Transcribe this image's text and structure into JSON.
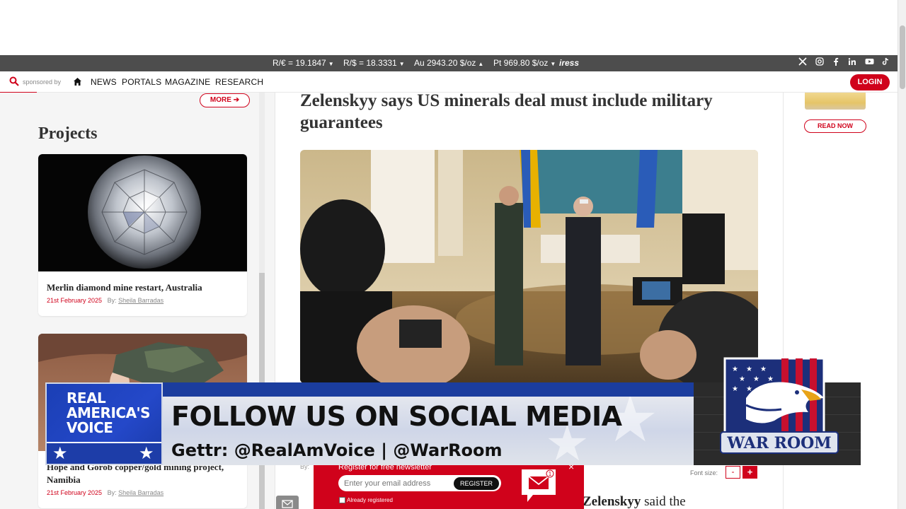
{
  "ticker": {
    "items": [
      {
        "label": "R/€ = 19.1847"
      },
      {
        "label": "R/$ = 18.3331"
      },
      {
        "label": "Au 2943.20 $/oz"
      },
      {
        "label": "Pt 969.80 $/oz"
      }
    ],
    "brand": "iress",
    "social_icons": [
      "x-icon",
      "instagram-icon",
      "facebook-icon",
      "linkedin-icon",
      "youtube-icon",
      "tiktok-icon"
    ]
  },
  "nav": {
    "sponsored_text": "sponsored by",
    "links": [
      "NEWS",
      "PORTALS",
      "MAGAZINE",
      "RESEARCH"
    ],
    "login_label": "LOGIN"
  },
  "sidebar": {
    "more_label": "MORE",
    "section_title": "Projects",
    "cards": [
      {
        "title": "Merlin diamond mine restart, Australia",
        "date": "21st February 2025",
        "by": "By:",
        "author": "Sheila Barradas"
      },
      {
        "title": "Hope and Gorob copper/gold mining project, Namibia",
        "date": "21st February 2025",
        "by": "By:",
        "author": "Sheila Barradas"
      }
    ]
  },
  "article": {
    "headline": "Zelenskyy says US minerals deal must include military guarantees",
    "byline": "By:",
    "font_size_label": "Font size:",
    "font_minus": "-",
    "font_plus": "+",
    "body_bold": "Zelenskyy",
    "body_rest": " said the"
  },
  "right_ad": {
    "read_now_label": "READ NOW"
  },
  "newsletter": {
    "title": "Register for free newsletter",
    "email_placeholder": "Enter your email address",
    "register_label": "REGISTER",
    "already_label": "Already registered",
    "close": "×",
    "badge": "1"
  },
  "banner": {
    "rav_lines": [
      "REAL",
      "AMERICA'S",
      "VOICE"
    ],
    "headline": "FOLLOW US ON SOCIAL MEDIA",
    "handles": "Gettr: @RealAmVoice  |  @WarRoom",
    "warroom_text": "WAR ROOM"
  },
  "colors": {
    "accent": "#d0021b",
    "ticker_bg": "#4d4d4d",
    "banner_blue": "#1b3d9e"
  }
}
